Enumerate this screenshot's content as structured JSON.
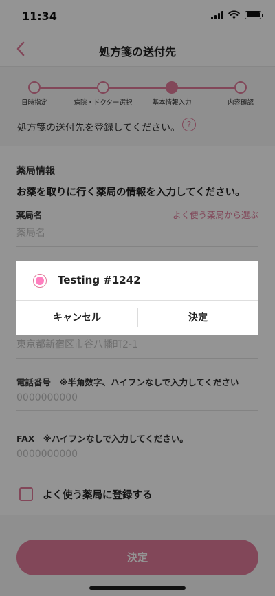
{
  "status_bar": {
    "time": "11:34"
  },
  "nav": {
    "title": "処方箋の送付先"
  },
  "stepper": {
    "steps": [
      "日時指定",
      "病院・ドクター選択",
      "基本情報入力",
      "内容確認"
    ],
    "current_step": 3
  },
  "notice": "処方箋の送付先を登録してください。",
  "help_icon_text": "?",
  "form": {
    "section_title": "薬局情報",
    "section_desc": "お薬を取りに行く薬局の情報を入力してください。",
    "pharmacy_name_label": "薬局名",
    "pharmacy_name_placeholder": "薬局名",
    "select_link": "よく使う薬局から選ぶ",
    "address_placeholder": "東京都新宿区市谷八幡町2-1",
    "phone_label": "電話番号",
    "phone_note": "※半角数字、ハイフンなしで入力してください",
    "phone_placeholder": "0000000000",
    "fax_label": "FAX",
    "fax_note": "※ハイフンなしで入力してください。",
    "fax_placeholder": "0000000000",
    "checkbox_label": "よく使う薬局に登録する",
    "submit_label": "決定"
  },
  "dialog": {
    "option_label": "Testing #1242",
    "option_selected": true,
    "cancel_label": "キャンセル",
    "confirm_label": "決定"
  },
  "colors": {
    "accent": "#e07a9a",
    "radio_fill": "#ff7fbf",
    "overlay": "rgba(0,0,0,0.42)"
  }
}
